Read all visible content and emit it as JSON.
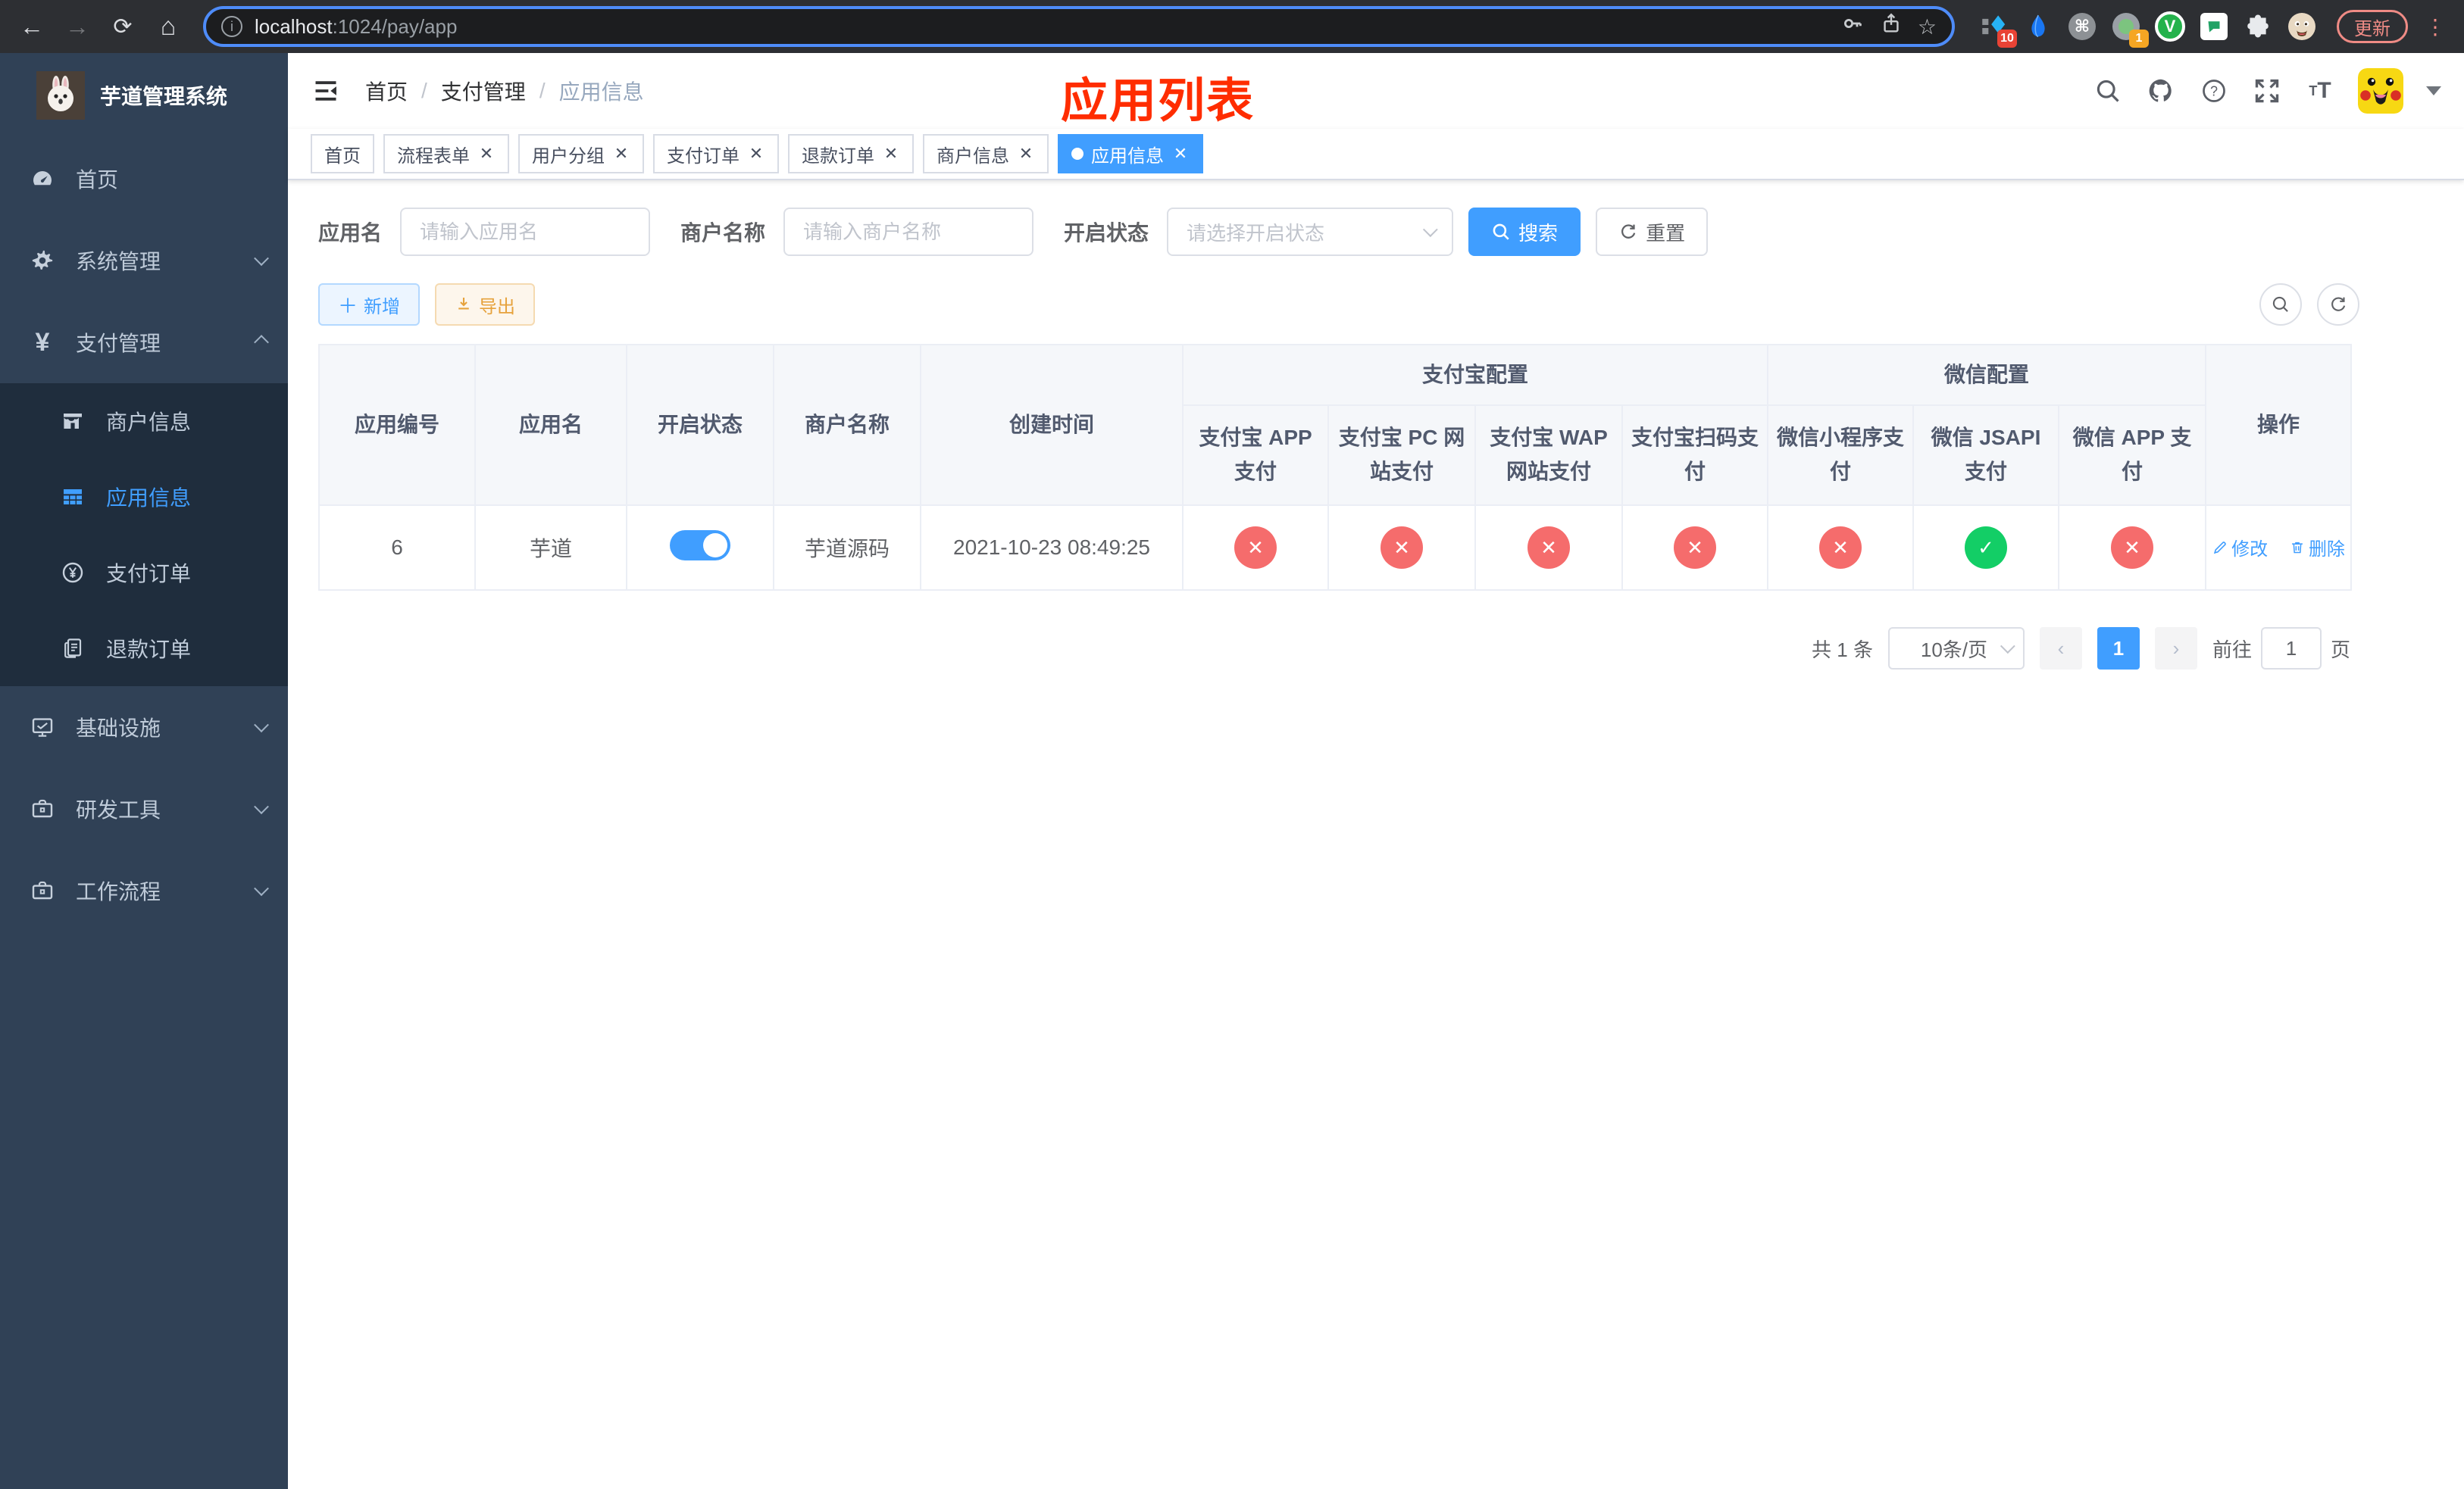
{
  "theme": {
    "primary": "#409eff",
    "danger": "#f56c6c",
    "success": "#13ce66",
    "warning": "#e6a23c",
    "sidebar_bg": "#304156",
    "submenu_bg": "#1f2d3d",
    "annotation_red": "#ff2d00"
  },
  "browser": {
    "url_host": "localhost",
    "url_rest": ":1024/pay/app",
    "update_button": "更新",
    "ext_badge_widget": "10",
    "ext_badge_status": "1",
    "ext_v_letter": "V",
    "cmd_glyph": "⌘"
  },
  "sidebar": {
    "logo_title": "芋道管理系统",
    "items": [
      {
        "label": "首页"
      },
      {
        "label": "系统管理"
      },
      {
        "label": "支付管理"
      },
      {
        "label": "基础设施"
      },
      {
        "label": "研发工具"
      },
      {
        "label": "工作流程"
      }
    ],
    "submenu": [
      {
        "label": "商户信息"
      },
      {
        "label": "应用信息"
      },
      {
        "label": "支付订单"
      },
      {
        "label": "退款订单"
      }
    ]
  },
  "navbar": {
    "breadcrumb": [
      "首页",
      "支付管理",
      "应用信息"
    ],
    "separator": "/"
  },
  "annotation": {
    "text": "应用列表"
  },
  "tags": [
    {
      "label": "首页"
    },
    {
      "label": "流程表单"
    },
    {
      "label": "用户分组"
    },
    {
      "label": "支付订单"
    },
    {
      "label": "退款订单"
    },
    {
      "label": "商户信息"
    },
    {
      "label": "应用信息"
    }
  ],
  "search": {
    "app_name_label": "应用名",
    "app_name_placeholder": "请输入应用名",
    "merchant_label": "商户名称",
    "merchant_placeholder": "请输入商户名称",
    "status_label": "开启状态",
    "status_placeholder": "请选择开启状态",
    "search_button": "搜索",
    "reset_button": "重置"
  },
  "toolbar": {
    "add_button": "新增",
    "export_button": "导出"
  },
  "table": {
    "columns_simple": [
      "应用编号",
      "应用名",
      "开启状态",
      "商户名称",
      "创建时间"
    ],
    "group_alipay": {
      "label": "支付宝配置",
      "children": [
        "支付宝 APP 支付",
        "支付宝 PC 网站支付",
        "支付宝 WAP 网站支付",
        "支付宝扫码支付"
      ]
    },
    "group_wechat": {
      "label": "微信配置",
      "children": [
        "微信小程序支付",
        "微信 JSAPI 支付",
        "微信 APP 支付"
      ]
    },
    "ops_label": "操作",
    "row": {
      "id": "6",
      "name": "芋道",
      "status_on": true,
      "merchant": "芋道源码",
      "created": "2021-10-23 08:49:25",
      "configs": [
        "no",
        "no",
        "no",
        "no",
        "no",
        "yes",
        "no"
      ],
      "ops": [
        "修改",
        "删除"
      ]
    }
  },
  "pagination": {
    "total_text": "共 1 条",
    "page_size": "10条/页",
    "current_page": "1",
    "goto_label": "前往",
    "goto_value": "1",
    "page_unit": "页"
  }
}
